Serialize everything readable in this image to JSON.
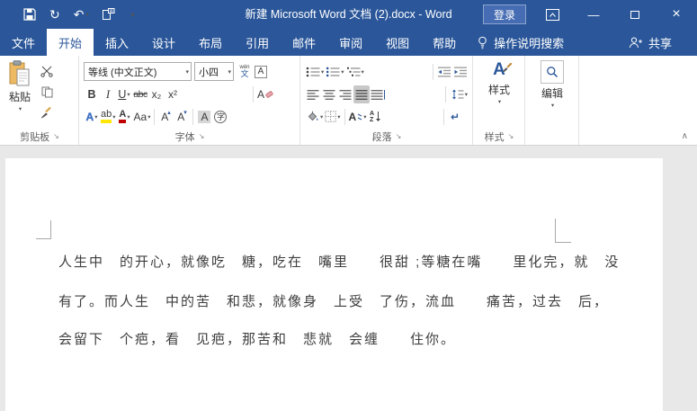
{
  "colors": {
    "accent": "#2b579a",
    "highlight_yellow": "#ffe604",
    "font_red": "#c00000",
    "doc_bg": "#e8e8e8",
    "selected_gray": "#c8c8c8"
  },
  "icons": {
    "undo": "↶",
    "redo": "↻",
    "caret": "▾",
    "minimize": "—",
    "close": "×",
    "collapse": "∧",
    "marks": "↵",
    "up": "▴",
    "down": "▾",
    "launcher": "↘"
  },
  "titlebar": {
    "title": "新建 Microsoft Word 文档 (2).docx  -  Word",
    "signin_label": "登录"
  },
  "menubar": {
    "tabs": [
      "文件",
      "开始",
      "插入",
      "设计",
      "布局",
      "引用",
      "邮件",
      "审阅",
      "视图",
      "帮助"
    ],
    "active_tab": "开始",
    "tellme": "操作说明搜索",
    "share": "共享"
  },
  "ribbon": {
    "clipboard": {
      "paste": "粘贴",
      "label": "剪贴板"
    },
    "font": {
      "name": "等线 (中文正文)",
      "size": "小四",
      "label": "字体",
      "bold": "B",
      "italic": "I",
      "underline": "U",
      "strike": "abc",
      "subscript": "x₂",
      "superscript": "x²",
      "clear": "A",
      "effects": "A",
      "highlight": "ab",
      "color": "A",
      "case": "Aa",
      "grow": "A",
      "shrink": "A",
      "shading": "A",
      "enclose": "字",
      "border": "A",
      "phonetic_top": "wén",
      "phonetic_bottom": "文"
    },
    "paragraph": {
      "label": "段落",
      "sort_top": "A",
      "sort_bottom": "Z",
      "asian": "A"
    },
    "styles": {
      "glyph": "A",
      "button": "样式",
      "label": "样式"
    },
    "editing": {
      "button": "编辑"
    }
  },
  "document": {
    "lines": [
      "人生中　的开心，就像吃　糖，吃在　嘴里　　很甜 ;等糖在嘴　　里化完，就　没",
      "有了。而人生　中的苦　和悲，就像身　上受　了伤，流血　　痛苦，过去　后，",
      "会留下　个疤，看　见疤，那苦和　悲就　会缠　　住你。"
    ]
  }
}
